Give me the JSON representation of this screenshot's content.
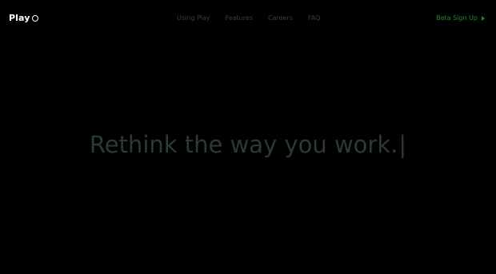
{
  "header": {
    "logo_text": "Play",
    "nav_items": [
      {
        "label": "Using Play"
      },
      {
        "label": "Features"
      },
      {
        "label": "Careers"
      },
      {
        "label": "FAQ"
      }
    ],
    "signup_label": "Beta Sign Up"
  },
  "hero": {
    "headline": "Rethink the way you work.",
    "cursor": "|"
  },
  "colors": {
    "background": "#000000",
    "accent": "#1f8a2b",
    "nav_text": "#3d3d3d",
    "headline": "#2b3a33"
  }
}
